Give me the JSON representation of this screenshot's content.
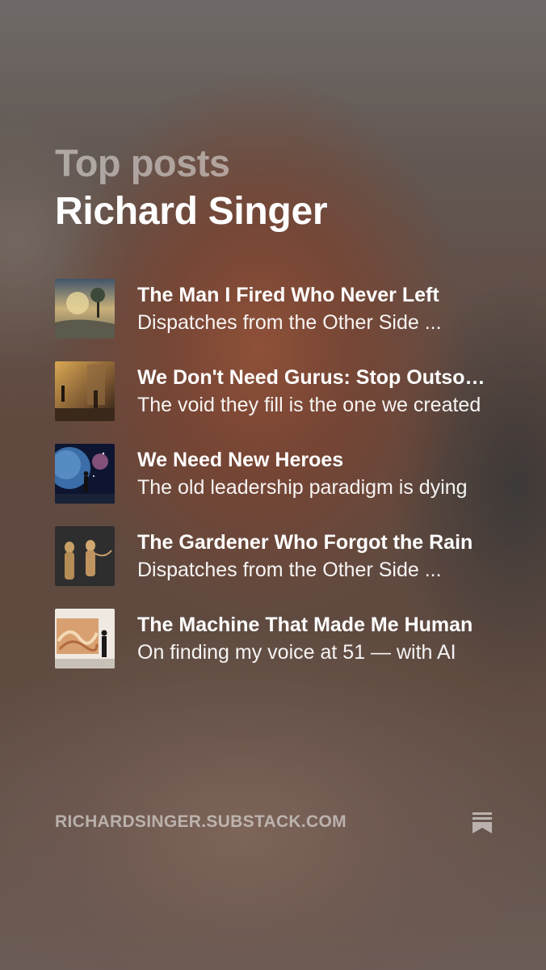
{
  "header": {
    "eyebrow": "Top posts",
    "author": "Richard Singer"
  },
  "posts": [
    {
      "title": "The Man I Fired Who Never Left",
      "subtitle": "Dispatches from the Other Side ...",
      "thumbnail_icon": "stormy-tree-painting-thumbnail"
    },
    {
      "title": "We Don't Need Gurus: Stop Outsourcing Your Wisdom",
      "subtitle": "The void they fill is the one we created",
      "thumbnail_icon": "figures-in-hall-thumbnail"
    },
    {
      "title": "We Need New Heroes",
      "subtitle": "The old leadership paradigm is dying",
      "thumbnail_icon": "figure-facing-planet-thumbnail"
    },
    {
      "title": "The Gardener Who Forgot the Rain",
      "subtitle": "Dispatches from the Other Side ...",
      "thumbnail_icon": "golden-figures-thumbnail"
    },
    {
      "title": "The Machine That Made Me Human",
      "subtitle": "On finding my voice at 51 — with AI",
      "thumbnail_icon": "man-viewing-artwork-thumbnail"
    }
  ],
  "footer": {
    "url": "RICHARDSINGER.SUBSTACK.COM",
    "brand_icon": "substack-bookmark-icon"
  },
  "colors": {
    "title_text": "#ffffff",
    "muted_text": "#d7d2d0"
  }
}
